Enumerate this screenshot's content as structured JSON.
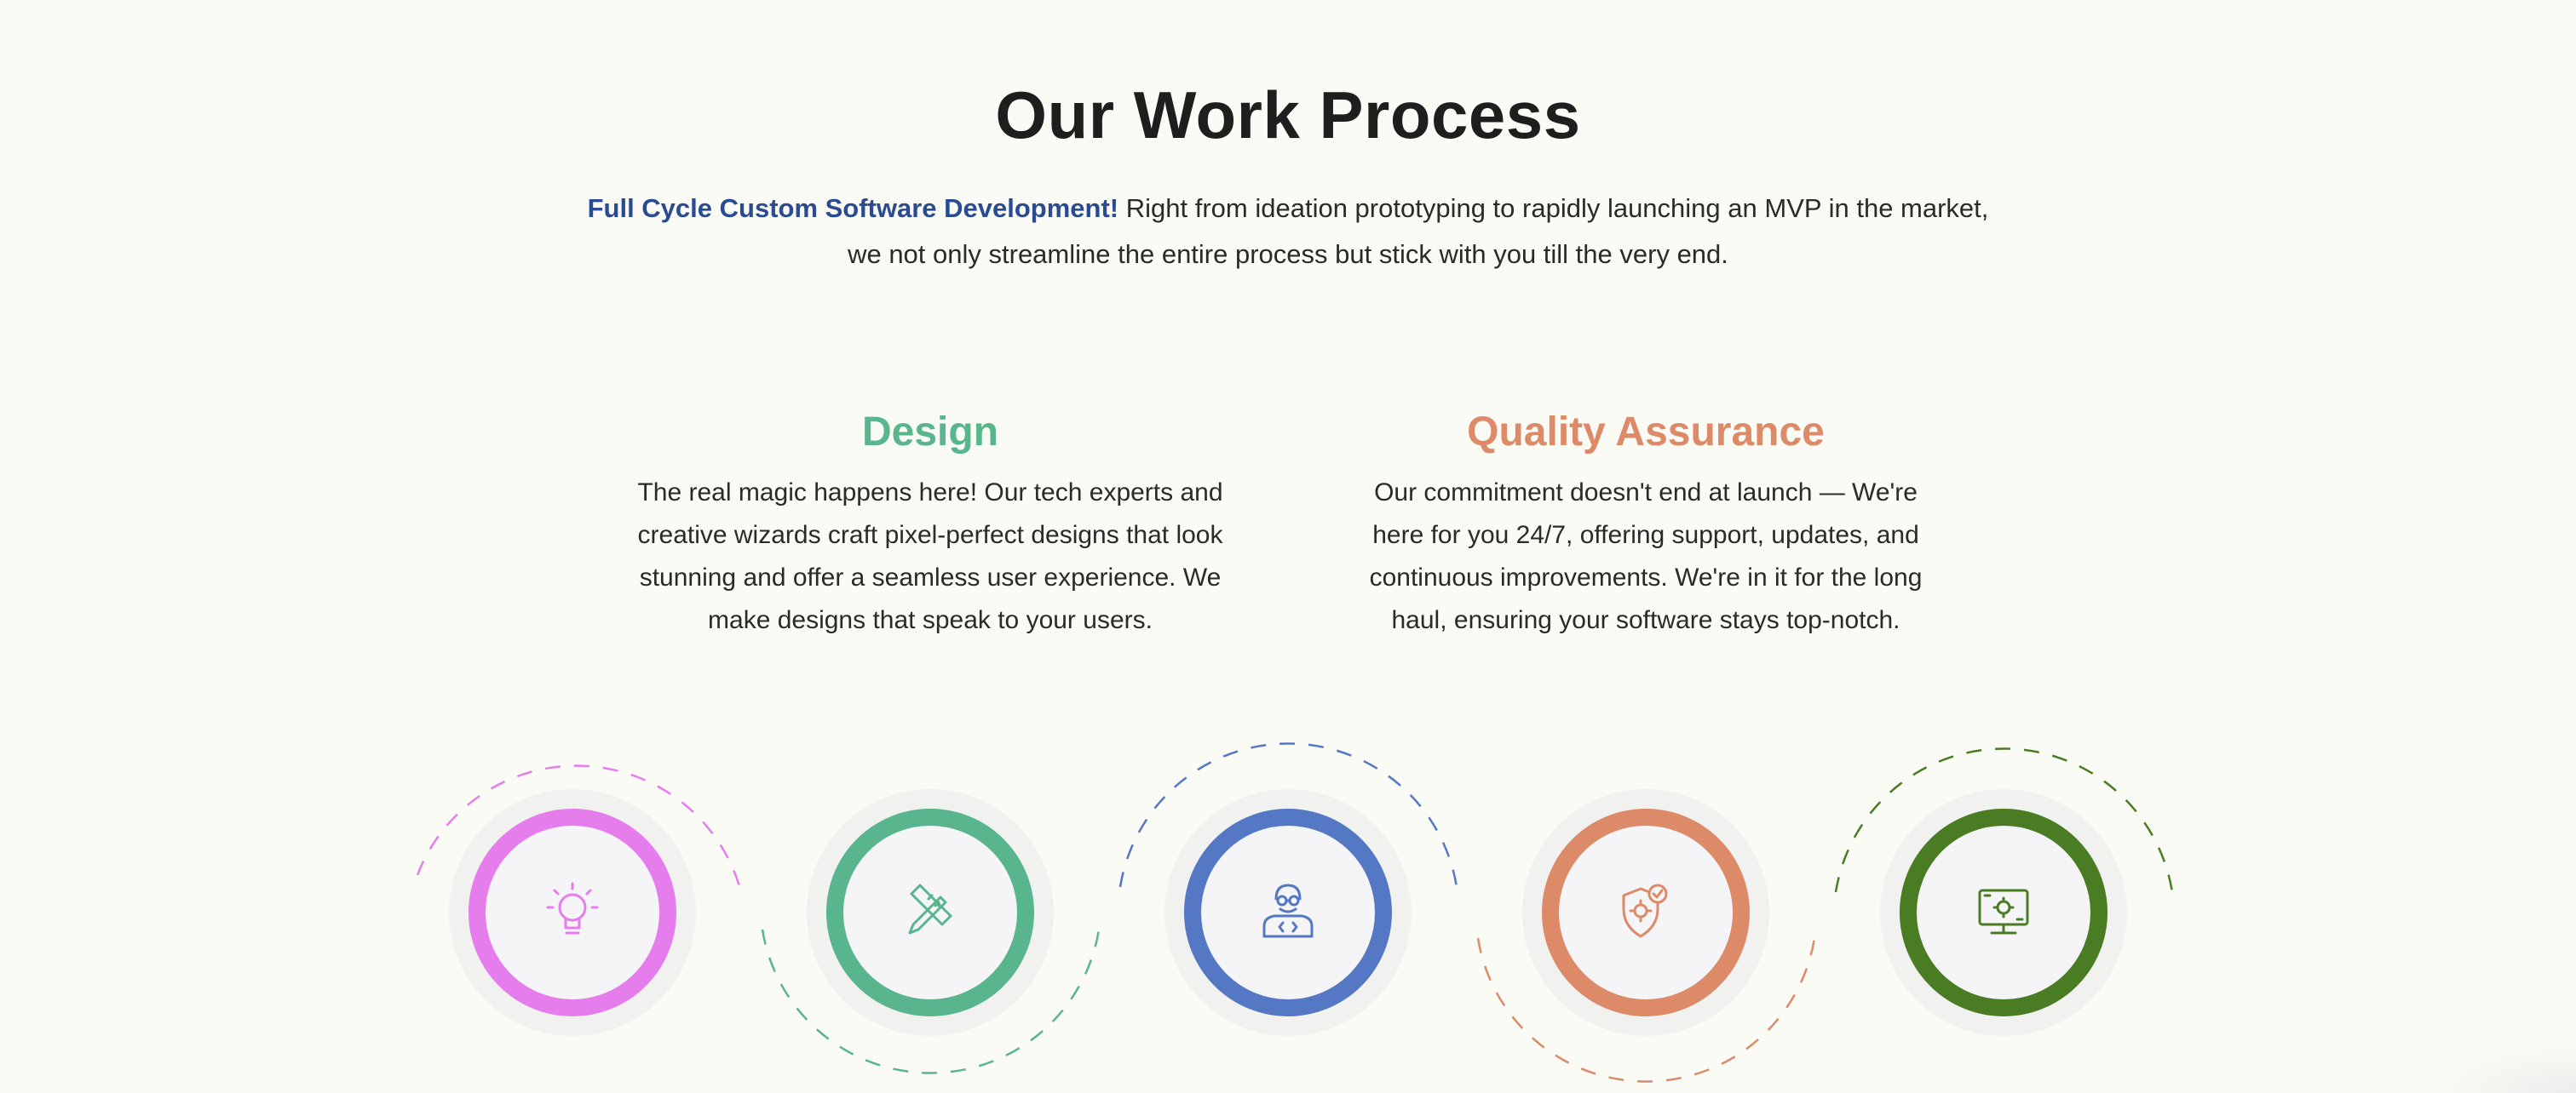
{
  "section": {
    "title": "Our Work Process",
    "intro_highlight": "Full Cycle Custom Software Development!",
    "intro_line1": " Right from ideation prototyping to rapidly launching an MVP in the market,",
    "intro_line2": "we not only streamline the entire process but stick with you till the very end."
  },
  "steps": {
    "design": {
      "title": "Design",
      "description": "The real magic happens here! Our tech experts and creative wizards craft pixel-perfect designs that look stunning and offer a seamless user experience. We make designs that speak to your users."
    },
    "quality_assurance": {
      "title": "Quality Assurance",
      "description": "Our commitment doesn't end at launch — We're here for you 24/7, offering support, updates, and continuous improvements. We're in it for the long haul, ensuring your software stays top-notch."
    }
  },
  "circles": [
    {
      "icon": "lightbulb-icon",
      "color": "#e67ded"
    },
    {
      "icon": "design-tools-icon",
      "color": "#58b58d"
    },
    {
      "icon": "developer-icon",
      "color": "#5578c4"
    },
    {
      "icon": "shield-check-icon",
      "color": "#dc8a68"
    },
    {
      "icon": "monitor-settings-icon",
      "color": "#4a7c23"
    }
  ]
}
